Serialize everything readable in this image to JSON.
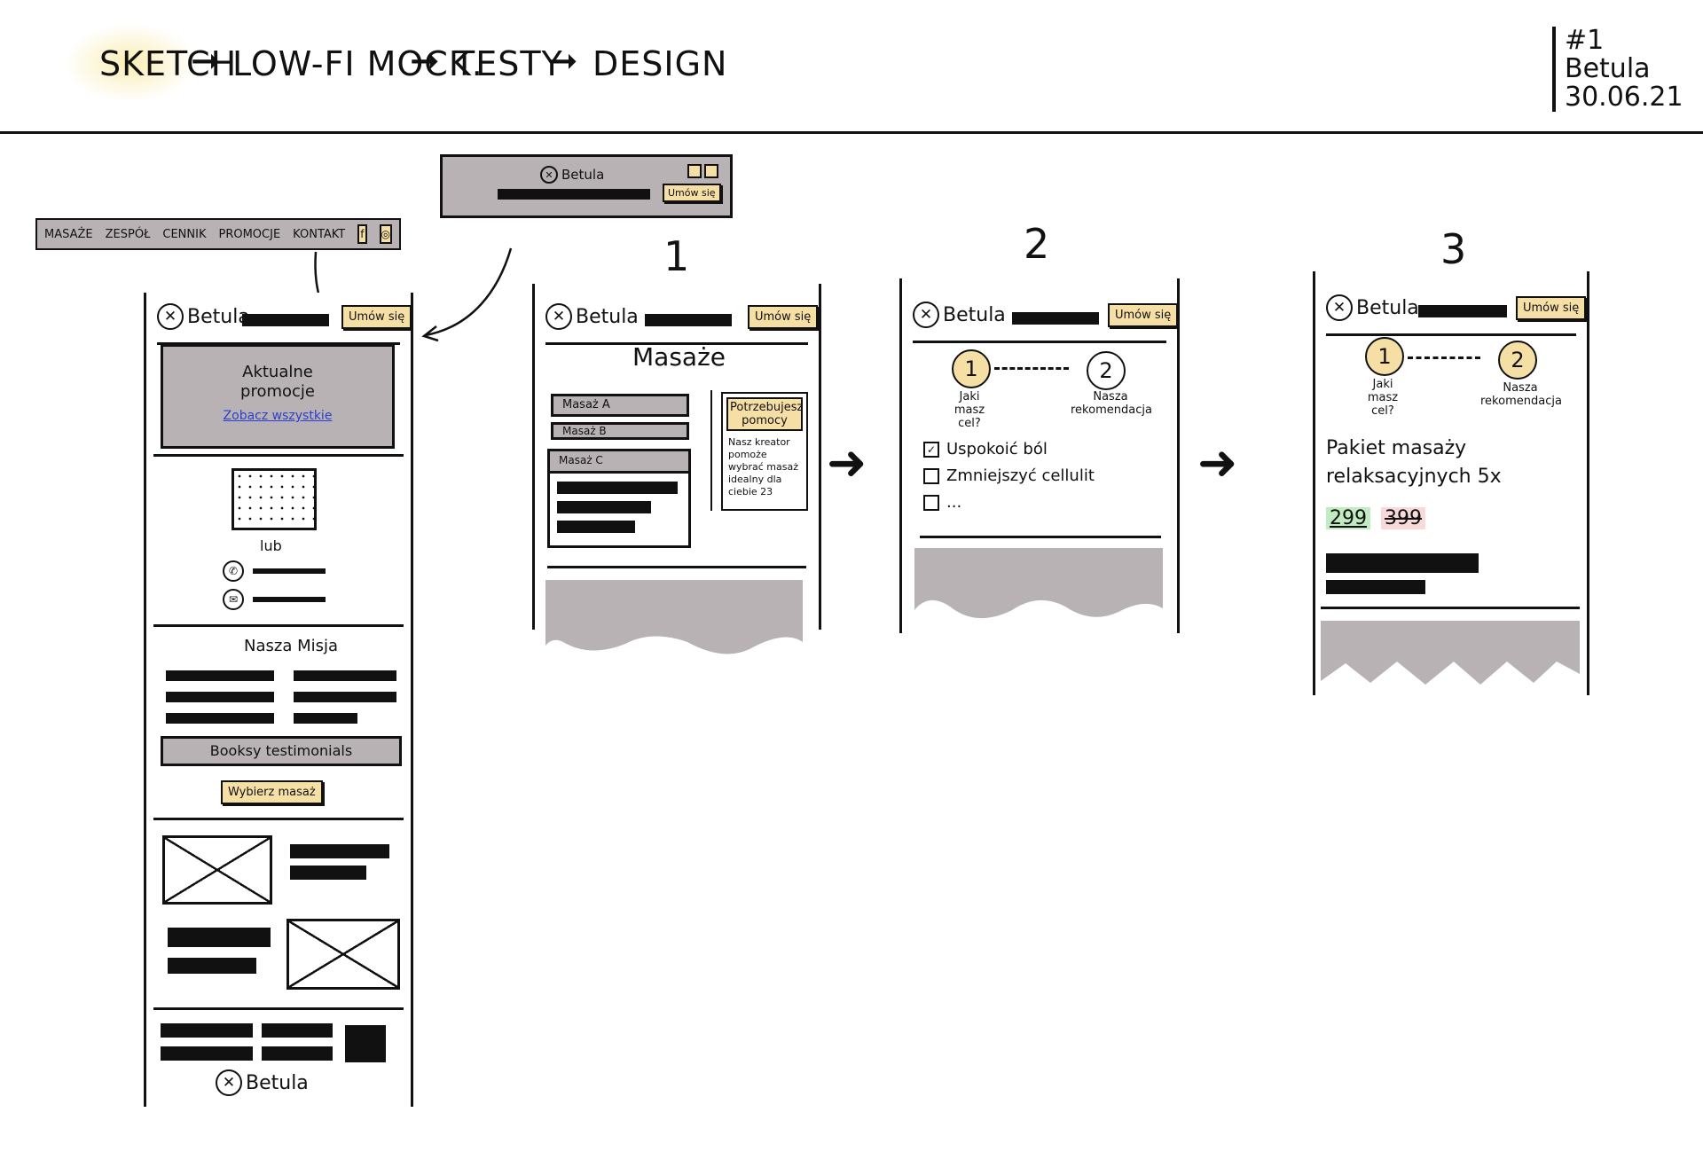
{
  "header": {
    "flow": [
      "SKETCH",
      "LOW-FI MOCK.",
      "TESTY",
      "DESIGN"
    ],
    "meta": {
      "number": "#1",
      "project": "Betula",
      "date": "30.06.21"
    }
  },
  "desktop_nav": {
    "items": [
      "MASAŻE",
      "ZESPÓŁ",
      "CENNIK",
      "PROMOCJE",
      "KONTAKT"
    ],
    "icons": [
      "facebook-icon",
      "instagram-icon"
    ]
  },
  "top_mobile_header": {
    "brand": "Betula",
    "cta": "Umów się"
  },
  "brand": "Betula",
  "cta": "Umów się",
  "home": {
    "promo_title": "Aktualne promocje",
    "promo_link": "Zobacz wszystkie",
    "or_label": "lub",
    "mission_title": "Nasza Misja",
    "testimonials": "Booksy testimonials",
    "choose_button": "Wybierz masaż",
    "footer_brand": "Betula"
  },
  "screens": [
    {
      "label": "1",
      "title": "Masaże",
      "items": [
        "Masaż A",
        "Masaż B",
        "Masaż C"
      ],
      "help_title": "Potrzebujesz pomocy",
      "help_text": "Nasz kreator pomoże wybrać masaż idealny dla ciebie 23"
    },
    {
      "label": "2",
      "step1": "1",
      "step2": "2",
      "step1_caption": "Jaki masz cel?",
      "step2_caption": "Nasza rekomendacja",
      "options": [
        "Uspokoić ból",
        "Zmniejszyć cellulit",
        "..."
      ]
    },
    {
      "label": "3",
      "step1": "1",
      "step2": "2",
      "step1_caption": "Jaki masz cel?",
      "step2_caption": "Nasza rekomendacja",
      "package": "Pakiet masaży relaksacyjnych 5x",
      "price_new": "299",
      "price_old": "399"
    }
  ],
  "colors": {
    "accent": "#f6dfa5",
    "gray": "#b8b2b4",
    "ink": "#111111"
  }
}
